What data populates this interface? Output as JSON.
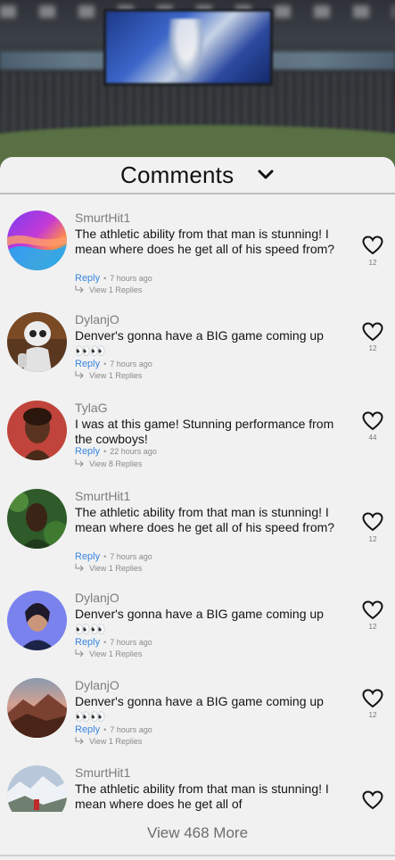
{
  "sheet": {
    "title": "Comments",
    "view_more": "View 468 More"
  },
  "comments": [
    {
      "username": "SmurtHit1",
      "text": "The athletic ability from that man is stunning! I mean where does he get all of his speed from?",
      "reply": "Reply",
      "time": "7 hours ago",
      "view_replies": "View 1 Replies",
      "likes": "12",
      "avatar": "gradient-abstract"
    },
    {
      "username": "DylanjO",
      "text": "Denver's gonna have a BIG game coming up 👀👀",
      "reply": "Reply",
      "time": "7 hours ago",
      "view_replies": "View 1 Replies",
      "likes": "12",
      "avatar": "robot"
    },
    {
      "username": "TylaG",
      "text": "I was at this game! Stunning performance from the cowboys!",
      "reply": "Reply",
      "time": "22 hours ago",
      "view_replies": "View 8 Replies",
      "likes": "44",
      "avatar": "woman-red"
    },
    {
      "username": "SmurtHit1",
      "text": "The athletic ability from that man is stunning! I mean where does he get all of his speed from?",
      "reply": "Reply",
      "time": "7 hours ago",
      "view_replies": "View 1 Replies",
      "likes": "12",
      "avatar": "woman-foliage"
    },
    {
      "username": "DylanjO",
      "text": "Denver's gonna have a BIG game coming up 👀👀",
      "reply": "Reply",
      "time": "7 hours ago",
      "view_replies": "View 1 Replies",
      "likes": "12",
      "avatar": "woman-blue"
    },
    {
      "username": "DylanjO",
      "text": "Denver's gonna have a BIG game coming up 👀👀",
      "reply": "Reply",
      "time": "7 hours ago",
      "view_replies": "View 1 Replies",
      "likes": "12",
      "avatar": "mountain-sunset"
    },
    {
      "username": "SmurtHit1",
      "text": "The athletic ability from that man is stunning! I mean where does he get all of",
      "avatar": "snow-mountain"
    }
  ],
  "colors": {
    "reply_link": "#3a86e0",
    "sheet_bg": "#f1f1f1"
  },
  "icons": {
    "collapse": "chevron-down-icon",
    "like": "heart-icon",
    "reply_thread": "reply-arrow-icon"
  }
}
